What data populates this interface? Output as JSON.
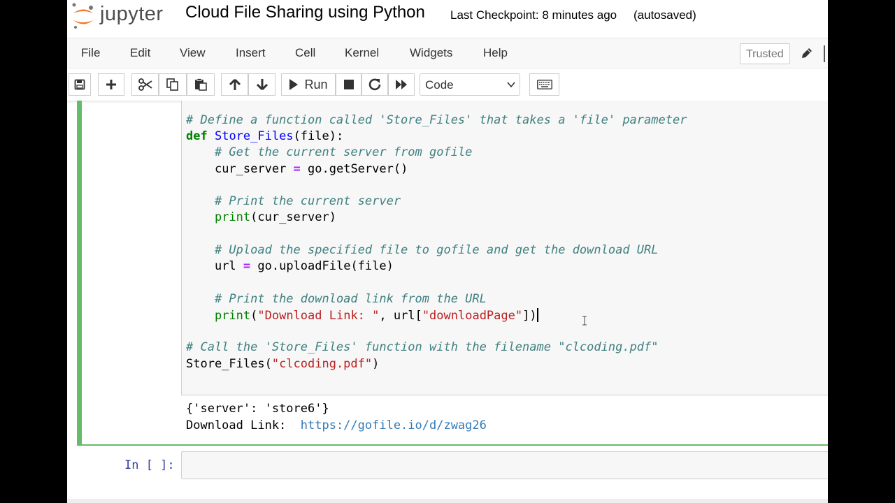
{
  "header": {
    "logo_text": "jupyter",
    "notebook_title": "Cloud File Sharing using Python",
    "checkpoint": "Last Checkpoint: 8 minutes ago",
    "autosave_status": "(autosaved)"
  },
  "menubar": {
    "items": [
      "File",
      "Edit",
      "View",
      "Insert",
      "Cell",
      "Kernel",
      "Widgets",
      "Help"
    ],
    "trusted_label": "Trusted"
  },
  "toolbar": {
    "run_label": "Run",
    "cell_type": "Code",
    "buttons": [
      "save-icon",
      "plus-icon",
      "cut-icon",
      "copy-icon",
      "paste-icon",
      "arrow-up-icon",
      "arrow-down-icon",
      "run-icon",
      "stop-icon",
      "restart-icon",
      "fast-forward-icon",
      "keyboard-icon"
    ]
  },
  "cell": {
    "code": {
      "c1": "# Define a function called 'Store_Files' that takes a 'file' parameter",
      "l2_kw": "def",
      "l2_name": "Store_Files",
      "l2_rest": "(file):",
      "c3": "# Get the current server from gofile",
      "l4_a": "cur_server ",
      "l4_op": "=",
      "l4_b": " go.getServer()",
      "c6": "# Print the current server",
      "l7_fn": "print",
      "l7_rest": "(cur_server)",
      "c9": "# Upload the specified file to gofile and get the download URL",
      "l10_a": "url ",
      "l10_op": "=",
      "l10_b": " go.uploadFile(file)",
      "c12": "# Print the download link from the URL",
      "l13_fn": "print",
      "l13_p1": "(",
      "l13_s1": "\"Download Link: \"",
      "l13_p2": ", url[",
      "l13_s2": "\"downloadPage\"",
      "l13_p3": "])",
      "c15": "# Call the 'Store_Files' function with the filename \"clcoding.pdf\"",
      "l16_a": "Store_Files(",
      "l16_s": "\"clcoding.pdf\"",
      "l16_b": ")"
    },
    "output": {
      "line1": "{'server': 'store6'}",
      "line2_label": "Download Link:  ",
      "line2_link": "https://gofile.io/d/zwag26"
    }
  },
  "next_cell": {
    "prompt": "In [ ]:"
  }
}
